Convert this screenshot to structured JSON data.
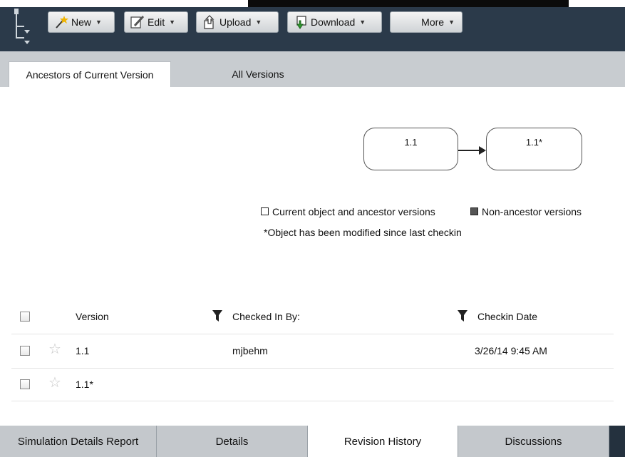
{
  "toolbar": {
    "new_label": "New",
    "edit_label": "Edit",
    "upload_label": "Upload",
    "download_label": "Download",
    "more_label": "More"
  },
  "tabs": [
    {
      "label": "Ancestors of Current Version",
      "active": true
    },
    {
      "label": "All Versions",
      "active": false
    }
  ],
  "diagram": {
    "nodes": [
      "1.1",
      "1.1*"
    ],
    "legend_current": "Current object and ancestor versions",
    "legend_non_ancestor": "Non-ancestor versions",
    "note": "*Object has been modified since last checkin"
  },
  "table": {
    "headers": [
      "Version",
      "Checked In By:",
      "Checkin Date"
    ],
    "rows": [
      {
        "version": "1.1",
        "checked_in_by": "mjbehm",
        "checkin_date": "3/26/14 9:45 AM"
      },
      {
        "version": "1.1*",
        "checked_in_by": "",
        "checkin_date": ""
      }
    ]
  },
  "bottom_tabs": [
    {
      "label": "Simulation Details Report",
      "active": false
    },
    {
      "label": "Details",
      "active": false
    },
    {
      "label": "Revision History",
      "active": true
    },
    {
      "label": "Discussions",
      "active": false
    }
  ],
  "colors": {
    "toolbar_bg": "#2b3a4a",
    "tab_strip_bg": "#c8ccd0",
    "bottom_bar_bg": "#24313e"
  },
  "icons": [
    "tree-icon",
    "magic-wand-icon",
    "edit-pencil-icon",
    "upload-icon",
    "download-icon",
    "filter-icon",
    "star-icon"
  ]
}
